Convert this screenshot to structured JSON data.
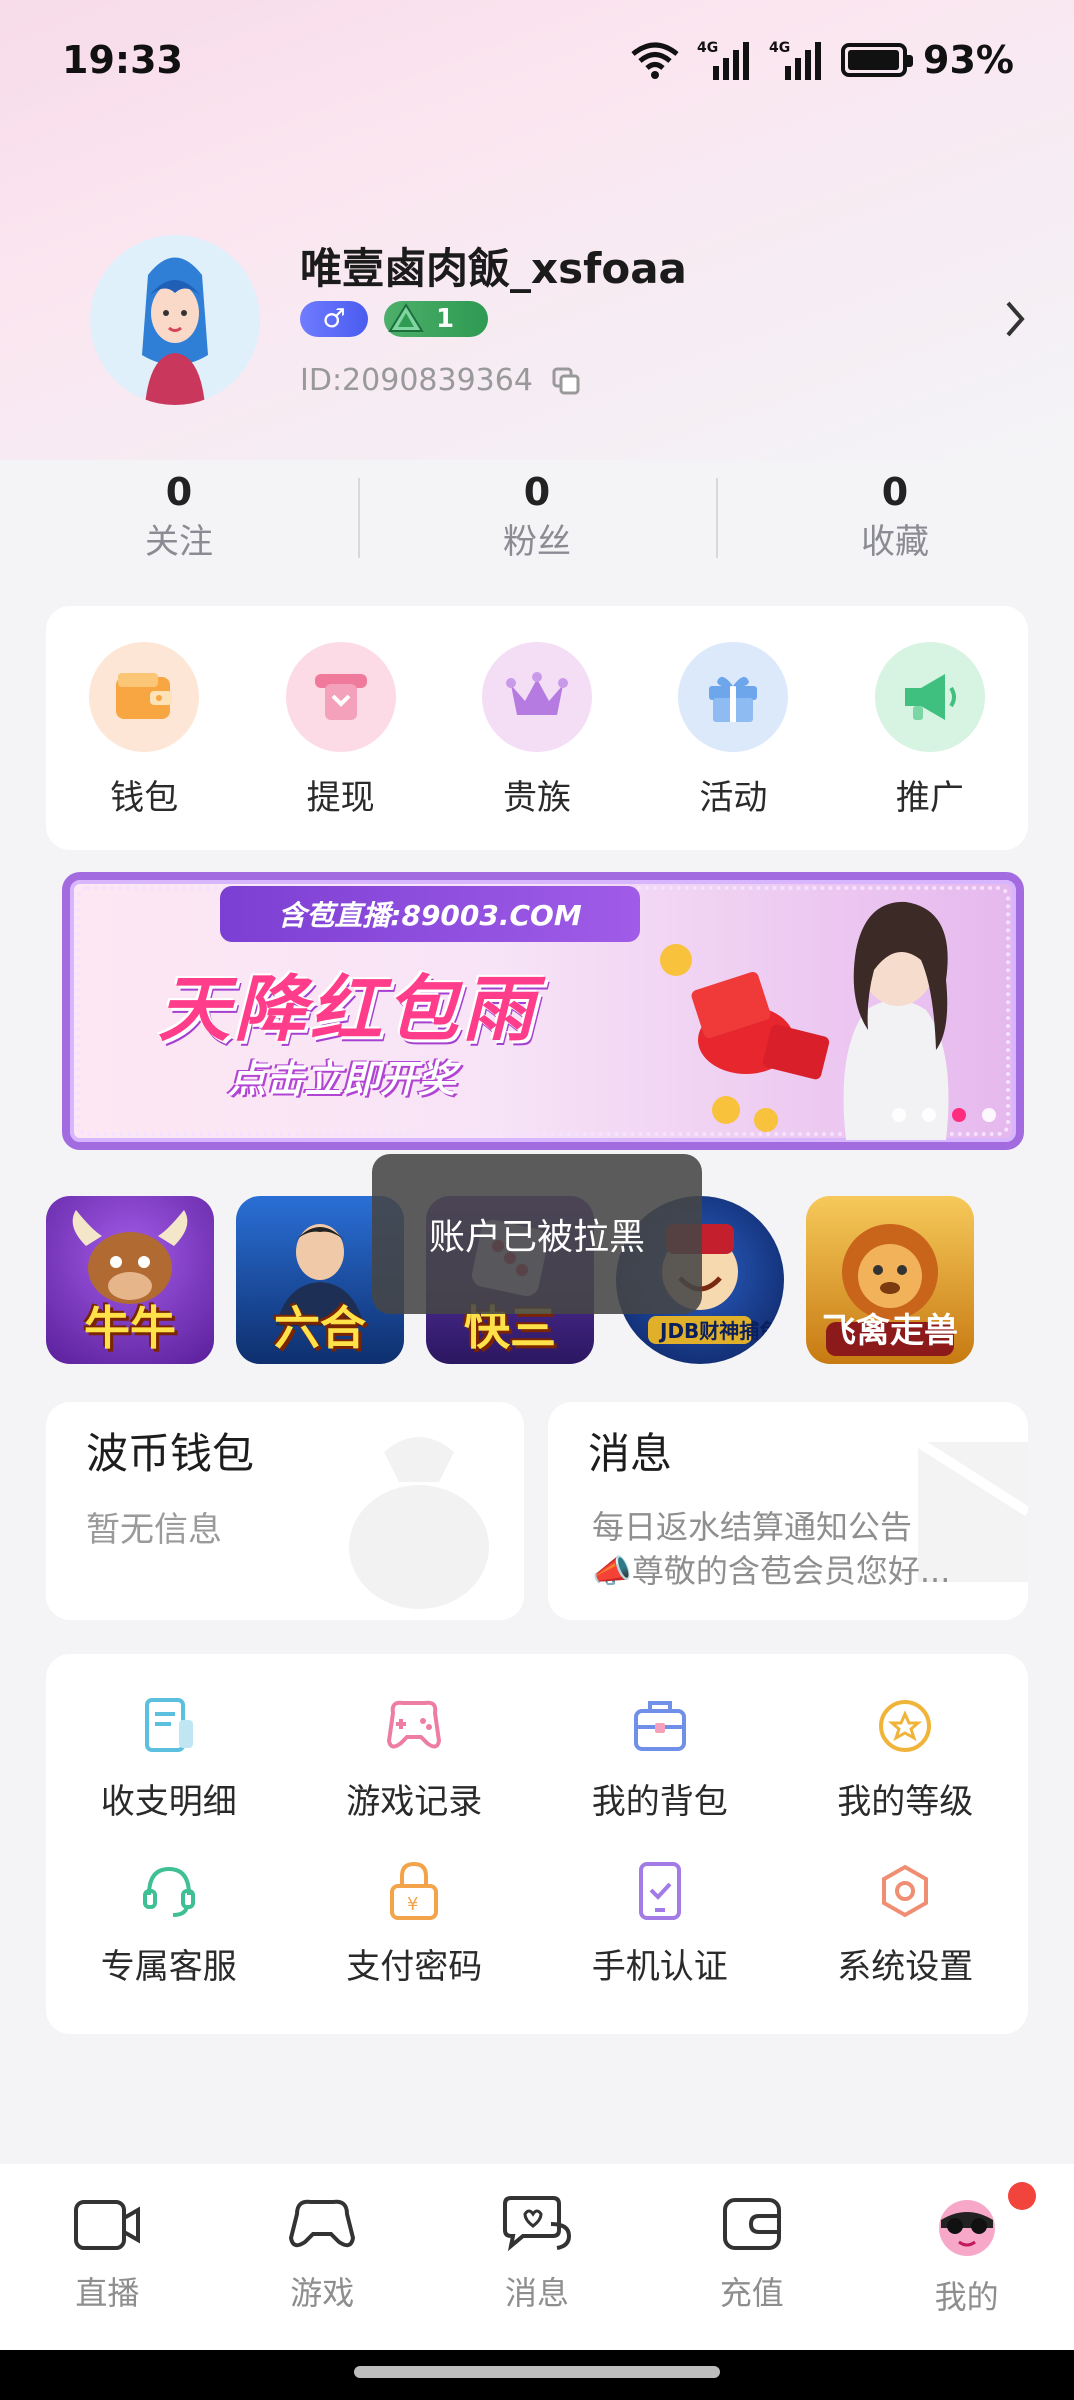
{
  "status_bar": {
    "time": "19:33",
    "network_1": "4G",
    "network_2": "4G",
    "battery": "93%"
  },
  "profile": {
    "username": "唯壹鹵肉飯_xsfoaa",
    "gender_symbol": "♂",
    "level": "1",
    "user_id": "ID:2090839364"
  },
  "stats": [
    {
      "value": "0",
      "label": "关注"
    },
    {
      "value": "0",
      "label": "粉丝"
    },
    {
      "value": "0",
      "label": "收藏"
    }
  ],
  "quick_actions": [
    {
      "label": "钱包",
      "icon": "wallet-icon",
      "color": "#fde2cf"
    },
    {
      "label": "提现",
      "icon": "withdraw-icon",
      "color": "#fbd6e3"
    },
    {
      "label": "贵族",
      "icon": "crown-icon",
      "color": "#f3dcf5"
    },
    {
      "label": "活动",
      "icon": "gift-icon",
      "color": "#d9e8fb"
    },
    {
      "label": "推广",
      "icon": "megaphone-icon",
      "color": "#d6f2e1"
    }
  ],
  "banner": {
    "top_text": "含苞直播:89003.COM",
    "title": "天降红包雨",
    "subtitle": "点击立即开奖",
    "pages": 4,
    "active_page": 3
  },
  "games": [
    {
      "label": "牛牛",
      "icon": "niuniu-game-icon"
    },
    {
      "label": "六合",
      "icon": "liuhe-game-icon"
    },
    {
      "label": "快三",
      "icon": "kuaisan-game-icon"
    },
    {
      "label": "JDB财神捕鱼",
      "icon": "jdb-fishing-game-icon"
    },
    {
      "label": "飞禽走兽",
      "icon": "feiqin-game-icon"
    }
  ],
  "toast": {
    "text": "账户已被拉黑"
  },
  "wallet_card": {
    "title": "波币钱包",
    "subtitle": "暂无信息"
  },
  "message_card": {
    "title": "消息",
    "line1": "每日返水结算通知公告",
    "line2": "📣尊敬的含苞会员您好..."
  },
  "menu_grid": [
    {
      "label": "收支明细",
      "icon": "bill-icon",
      "color": "#5bc0de"
    },
    {
      "label": "游戏记录",
      "icon": "gamepad-icon",
      "color": "#ee7da4"
    },
    {
      "label": "我的背包",
      "icon": "bag-icon",
      "color": "#6f8fe8"
    },
    {
      "label": "我的等级",
      "icon": "star-badge-icon",
      "color": "#f0b43a"
    },
    {
      "label": "专属客服",
      "icon": "headset-icon",
      "color": "#3fbf94"
    },
    {
      "label": "支付密码",
      "icon": "lock-icon",
      "color": "#f3a34a"
    },
    {
      "label": "手机认证",
      "icon": "phone-check-icon",
      "color": "#a27be6"
    },
    {
      "label": "系统设置",
      "icon": "settings-icon",
      "color": "#f08e74"
    }
  ],
  "tabbar": [
    {
      "label": "直播",
      "icon": "video-icon"
    },
    {
      "label": "游戏",
      "icon": "gamepad-icon"
    },
    {
      "label": "消息",
      "icon": "chat-icon"
    },
    {
      "label": "充值",
      "icon": "wallet-icon"
    },
    {
      "label": "我的",
      "icon": "avatar-tab-icon"
    }
  ]
}
